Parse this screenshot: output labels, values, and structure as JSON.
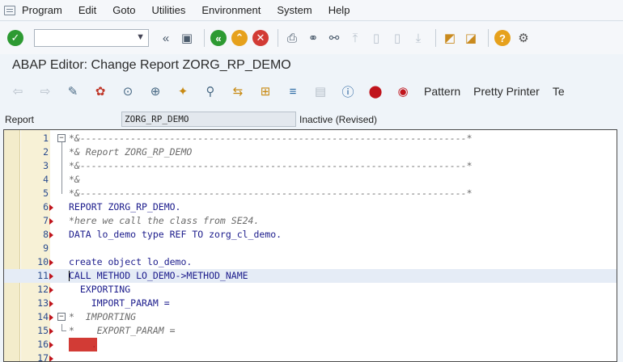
{
  "menubar": {
    "items": [
      "Program",
      "Edit",
      "Goto",
      "Utilities",
      "Environment",
      "System",
      "Help"
    ]
  },
  "std_toolbar": {
    "command_field_value": "",
    "icons": [
      "enter-icon",
      "back-icon",
      "save-icon",
      "exit-icon",
      "up-icon",
      "cancel-icon",
      "print-icon",
      "find-icon",
      "find-next-icon",
      "first-page-icon",
      "prev-page-icon",
      "next-page-icon",
      "last-page-icon",
      "new-session-icon",
      "shortcut-icon",
      "help-icon",
      "settings-icon"
    ]
  },
  "title": "ABAP Editor: Change Report ZORG_RP_DEMO",
  "app_toolbar": {
    "pattern_label": "Pretty Printer",
    "pattern_btn": "Pattern",
    "more_label": "Te"
  },
  "report": {
    "label": "Report",
    "value": "ZORG_RP_DEMO",
    "status": "Inactive (Revised)"
  },
  "editor": {
    "lines": [
      {
        "n": "1",
        "text": "*&---------------------------------------------------------------------*"
      },
      {
        "n": "2",
        "text": "*& Report ZORG_RP_DEMO"
      },
      {
        "n": "3",
        "text": "*&---------------------------------------------------------------------*"
      },
      {
        "n": "4",
        "text": "*&"
      },
      {
        "n": "5",
        "text": "*&---------------------------------------------------------------------*"
      },
      {
        "n": "6",
        "text": "REPORT ZORG_RP_DEMO."
      },
      {
        "n": "7",
        "text": "*here we call the class from SE24."
      },
      {
        "n": "8",
        "text": "DATA lo_demo type REF TO zorg_cl_demo."
      },
      {
        "n": "9",
        "text": ""
      },
      {
        "n": "10",
        "text": "create object lo_demo."
      },
      {
        "n": "11",
        "text": "CALL METHOD LO_DEMO->METHOD_NAME"
      },
      {
        "n": "12",
        "text": "  EXPORTING"
      },
      {
        "n": "13",
        "text": "    IMPORT_PARAM ="
      },
      {
        "n": "14",
        "text": "*  IMPORTING"
      },
      {
        "n": "15",
        "text": "*    EXPORT_PARAM ="
      },
      {
        "n": "16",
        "text": "    ."
      },
      {
        "n": "17",
        "text": ""
      }
    ]
  },
  "colors": {
    "keyword": "#1c1c8c",
    "comment": "#6b6b6b",
    "breakpoint": "#c0141c",
    "gutter": "#f3eccb"
  }
}
